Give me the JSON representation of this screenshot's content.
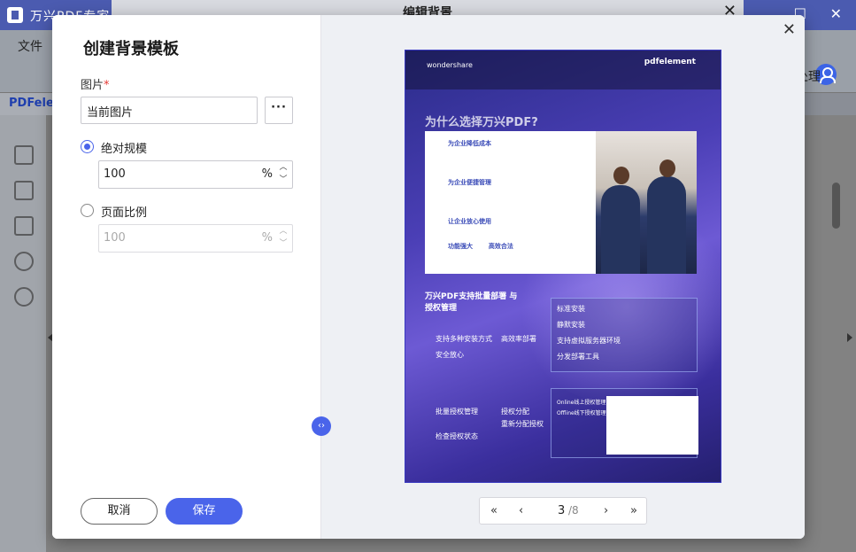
{
  "app": {
    "title": "万兴PDF专家",
    "menu_file": "文件",
    "menu_process": "处理",
    "doc_tab": "PDFelem"
  },
  "outer_dialog": {
    "title": "编辑背景"
  },
  "modal": {
    "title": "创建背景模板",
    "image_label": "图片",
    "required_mark": "*",
    "image_value": "当前图片",
    "more_button": "···",
    "absolute_scale_label": "绝对规模",
    "absolute_scale_value": "100",
    "absolute_scale_unit": "%",
    "page_ratio_label": "页面比例",
    "page_ratio_value": "100",
    "page_ratio_unit": "%",
    "selected_option": "绝对规模",
    "cancel_label": "取消",
    "save_label": "保存"
  },
  "preview": {
    "brand_left": "wondershare",
    "brand_right": "pdfelement",
    "heading": "为什么选择万兴PDF?",
    "card_items": [
      "为企业降低成本",
      "为企业便捷管理",
      "让企业放心使用"
    ],
    "card_footer": [
      "功能强大",
      "高效合法"
    ],
    "section_title": "万兴PDF支持批量部署 与授权管理",
    "section_left_items": [
      "支持多种安装方式",
      "高效率部署",
      "安全放心"
    ],
    "section_bottom_items": [
      "批量授权管理",
      "授权分配",
      "重新分配授权",
      "检查授权状态"
    ],
    "box_top": [
      "标准安装",
      "静默安装",
      "支持虚拟服务器环境",
      "分发部署工具"
    ],
    "box_bottom": [
      "Online线上授权管理",
      "Offline线下授权管理"
    ]
  },
  "pager": {
    "first": "«",
    "prev": "‹",
    "current": "3",
    "total": "/8",
    "next": "›",
    "last": "»"
  },
  "colors": {
    "accent": "#4a64ea",
    "titlebar": "#4b5bb0",
    "required": "#e53935"
  }
}
